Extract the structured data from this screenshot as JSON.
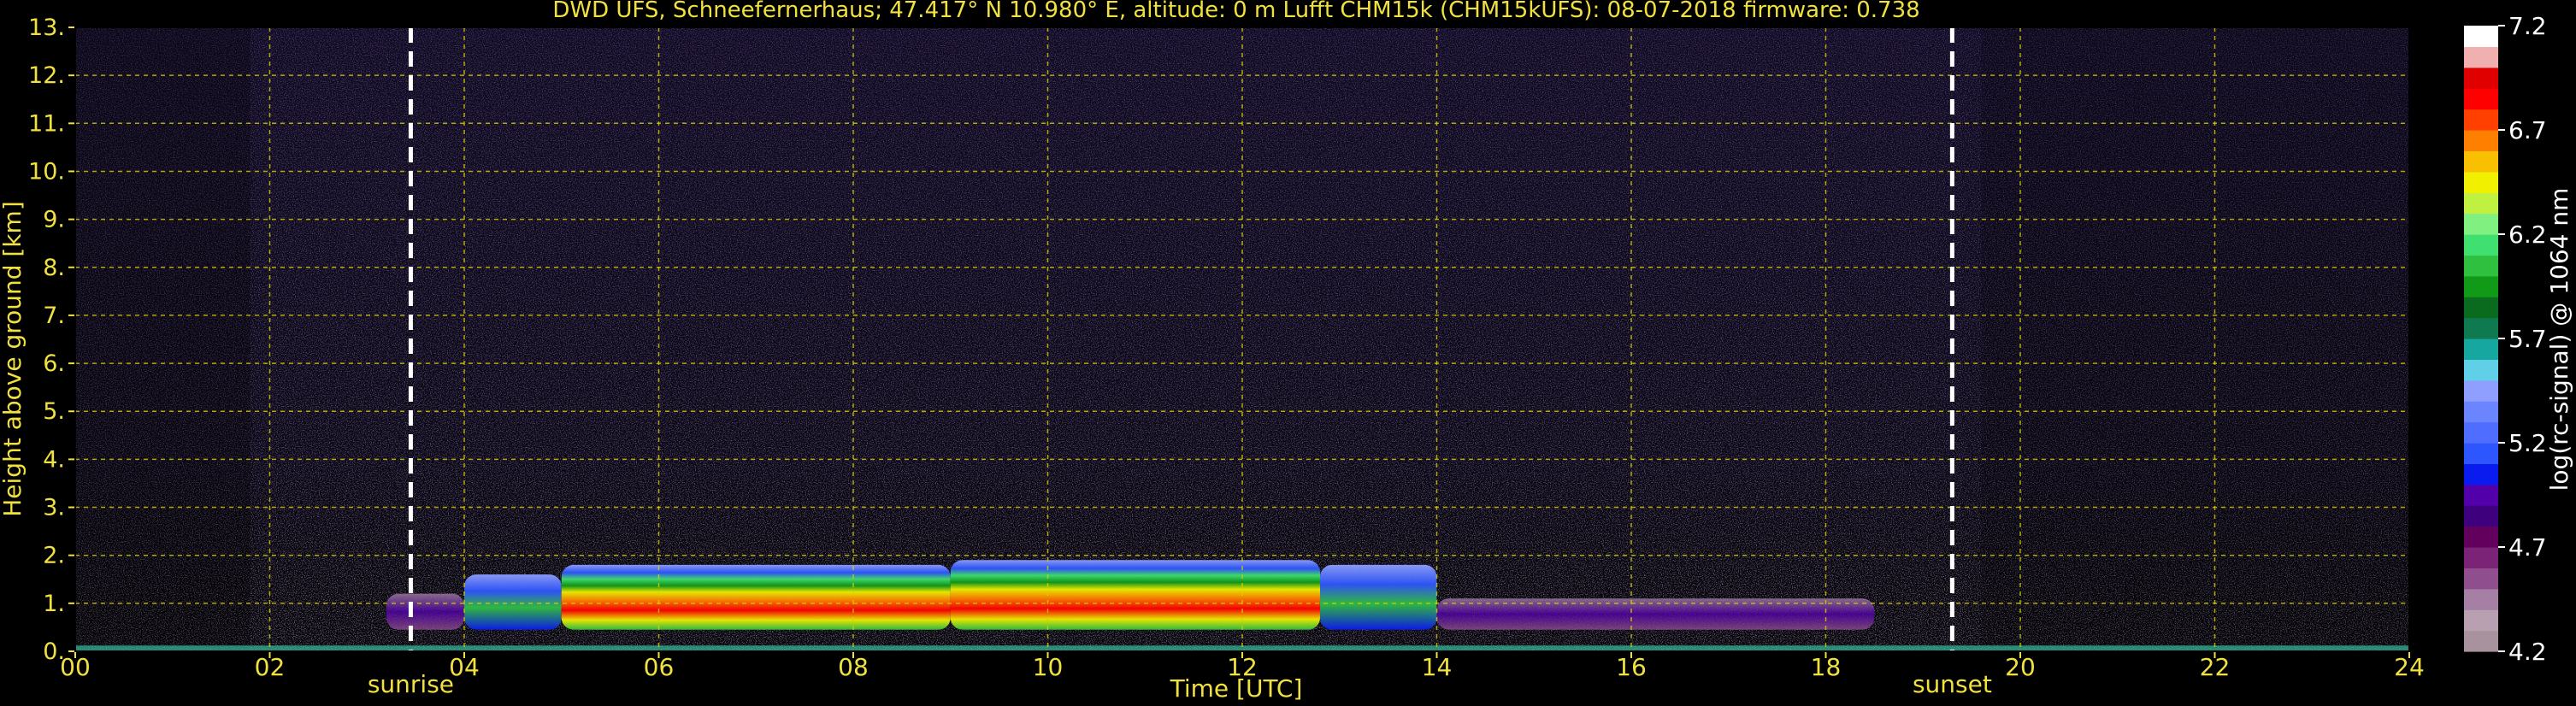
{
  "chart_data": {
    "type": "heatmap",
    "title": "DWD UFS, Schneefernerhaus; 47.417° N 10.980° E, altitude: 0 m    Lufft CHM15k (CHM15kUFS): 08-07-2018    firmware: 0.738",
    "xlabel": "Time [UTC]",
    "ylabel": "Height above ground [km]",
    "x_ticks": [
      "00",
      "02",
      "04",
      "06",
      "08",
      "10",
      "12",
      "14",
      "16",
      "18",
      "20",
      "22",
      "24"
    ],
    "y_ticks": [
      "0.",
      "1.",
      "2.",
      "3.",
      "4.",
      "5.",
      "6.",
      "7.",
      "8.",
      "9.",
      "10.",
      "11.",
      "12.",
      "13."
    ],
    "xlim": [
      0,
      24
    ],
    "ylim": [
      0,
      13
    ],
    "grid": true,
    "annotations": [
      {
        "label": "sunrise",
        "x": 3.45
      },
      {
        "label": "sunset",
        "x": 19.3
      }
    ],
    "colorbar": {
      "label": "log(rc-signal) @ 1064 nm",
      "range": [
        4.2,
        7.2
      ],
      "ticks": [
        "4.2",
        "4.7",
        "5.2",
        "5.7",
        "6.2",
        "6.7",
        "7.2"
      ],
      "colors": [
        "#a8929e",
        "#b9a0b1",
        "#a580a4",
        "#8f4f8f",
        "#7b2377",
        "#63005e",
        "#3e007c",
        "#5100aa",
        "#0a1bf0",
        "#2e56ff",
        "#4f6dff",
        "#6a85ff",
        "#8f9fff",
        "#5fd0e8",
        "#16a8a0",
        "#0f7a50",
        "#0a6a1e",
        "#109a18",
        "#30c040",
        "#40e070",
        "#80f080",
        "#c0f040",
        "#f0f000",
        "#f8c000",
        "#ff8000",
        "#ff4000",
        "#ff0000",
        "#e00000",
        "#f0b0b0",
        "#ffffff"
      ]
    },
    "cloud_layer_segments": [
      {
        "x_start": 3.2,
        "x_end": 4.0,
        "top_km": 1.2,
        "level": "low"
      },
      {
        "x_start": 4.0,
        "x_end": 5.0,
        "top_km": 1.6,
        "level": "medium"
      },
      {
        "x_start": 5.0,
        "x_end": 9.0,
        "top_km": 1.8,
        "level": "high"
      },
      {
        "x_start": 9.0,
        "x_end": 12.8,
        "top_km": 1.9,
        "level": "high"
      },
      {
        "x_start": 12.8,
        "x_end": 14.0,
        "top_km": 1.8,
        "level": "medium"
      },
      {
        "x_start": 14.0,
        "x_end": 18.5,
        "top_km": 1.1,
        "level": "low"
      }
    ]
  }
}
